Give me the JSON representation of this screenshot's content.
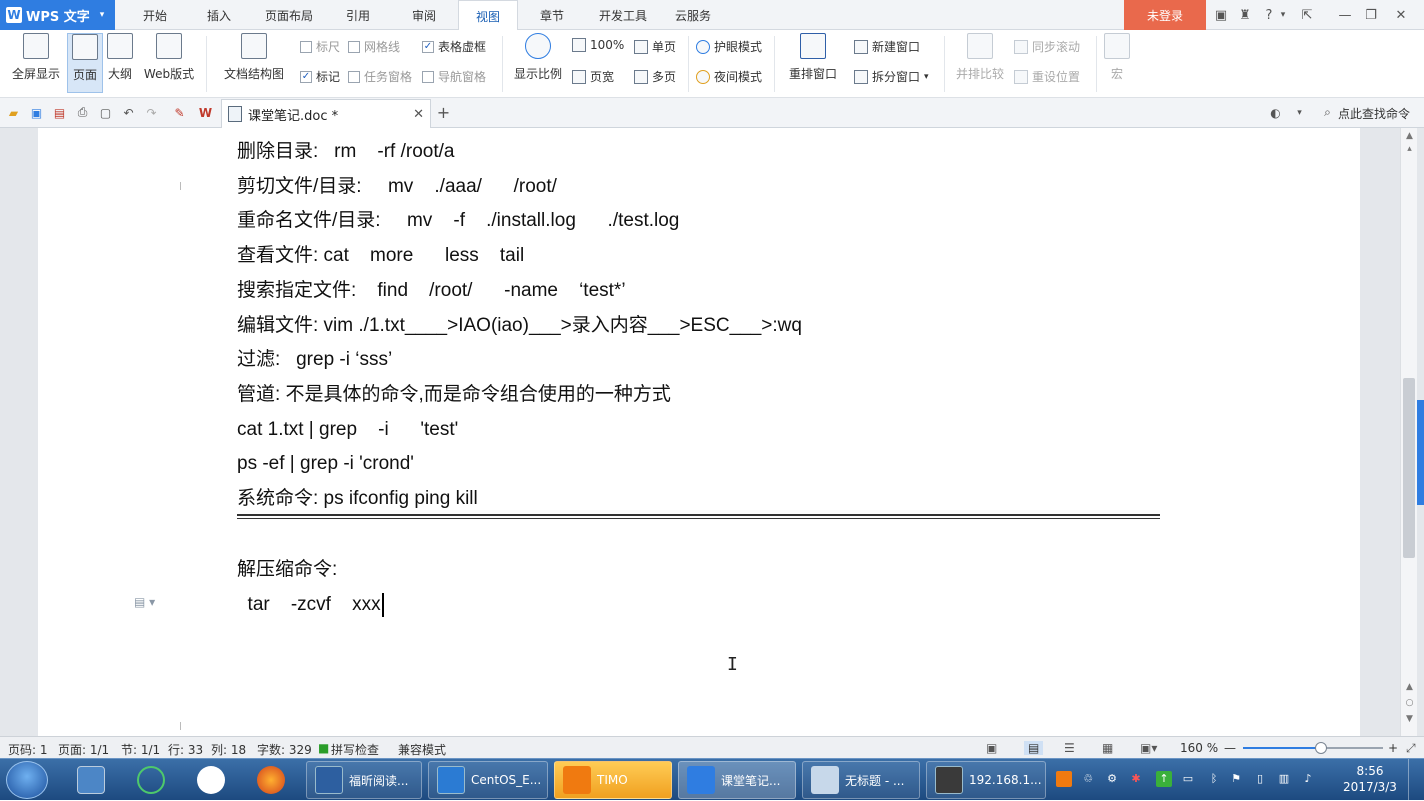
{
  "title_bar": {
    "app_name": "WPS 文字",
    "tabs": [
      "开始",
      "插入",
      "页面布局",
      "引用",
      "审阅",
      "视图",
      "章节",
      "开发工具",
      "云服务"
    ],
    "active_tab": "视图",
    "login": "未登录"
  },
  "ribbon": {
    "views": [
      "全屏显示",
      "页面",
      "大纲",
      "Web版式"
    ],
    "doc_structure": "文档结构图",
    "checks": {
      "ruler": "标尺",
      "grid": "网格线",
      "table_border": "表格虚框",
      "mark": "标记",
      "task_pane": "任务窗格",
      "nav_pane": "导航窗格"
    },
    "zoom": "显示比例",
    "zoom_100": "100%",
    "page_width": "页宽",
    "single_page": "单页",
    "multi_page": "多页",
    "eye_mode": "护眼模式",
    "night_mode": "夜间模式",
    "rearrange": "重排窗口",
    "new_window": "新建窗口",
    "split": "拆分窗口",
    "side_by_side": "并排比较",
    "sync_scroll": "同步滚动",
    "reset_pos": "重设位置",
    "macro": "宏"
  },
  "quick_access": {
    "doc_tab": "课堂笔记.doc *",
    "find_cmd": "点此查找命令"
  },
  "document": {
    "lines": [
      "删除目录:   rm    -rf /root/a",
      "剪切文件/目录:     mv    ./aaa/      /root/",
      "重命名文件/目录:     mv    -f    ./install.log      ./test.log",
      "查看文件: cat    more      less    tail",
      "搜索指定文件:    find    /root/      -name    ‘test*’",
      "编辑文件: vim ./1.txt____>IAO(iao)___>录入内容___>ESC___>:wq",
      "过滤:   grep -i ‘sss’",
      "管道: 不是具体的命令,而是命令组合使用的一种方式",
      "cat 1.txt | grep    -i      'test'",
      "ps -ef | grep -i 'crond'",
      "系统命令: ps ifconfig ping kill"
    ],
    "section_title": "解压缩命令:",
    "last_line": "  tar    -zcvf    xxx"
  },
  "status_bar": {
    "page_num": "页码: 1",
    "page": "页面: 1/1",
    "section": "节: 1/1",
    "row": "行: 33",
    "col": "列: 18",
    "word_count": "字数: 329",
    "spell": "拼写检查",
    "compat": "兼容模式",
    "zoom": "160 %",
    "zoom_level": 0.56
  },
  "taskbar": {
    "tasks": [
      "福昕阅读...",
      "CentOS_E...",
      "TIMO",
      "课堂笔记...",
      "无标题 - ...",
      "192.168.1..."
    ],
    "time": "8:56",
    "date": "2017/3/3"
  },
  "colors": {
    "accent": "#2f7de1",
    "login": "#e9694c",
    "taskbar": "#1d4a80"
  }
}
